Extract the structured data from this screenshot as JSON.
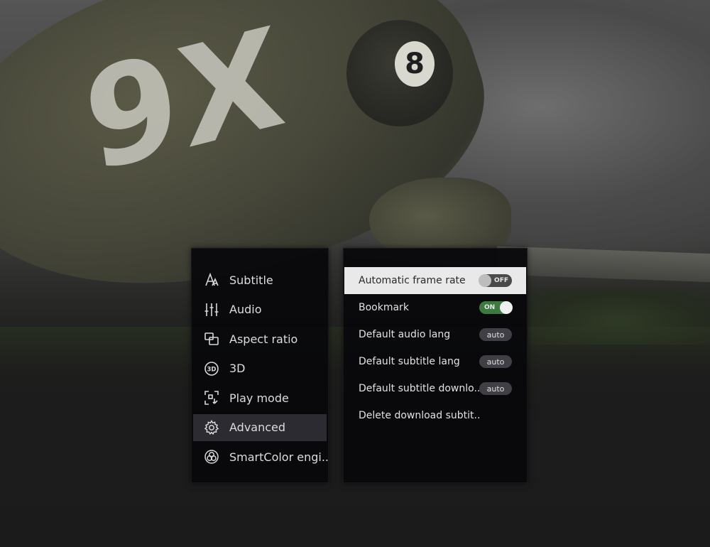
{
  "background": {
    "tail_code": "9X",
    "roundel_number": "8"
  },
  "menu": {
    "items": [
      {
        "label": "Subtitle",
        "icon": "subtitle-icon"
      },
      {
        "label": "Audio",
        "icon": "audio-equalizer-icon"
      },
      {
        "label": "Aspect ratio",
        "icon": "aspect-ratio-icon"
      },
      {
        "label": "3D",
        "icon": "3d-icon"
      },
      {
        "label": "Play mode",
        "icon": "play-mode-icon"
      },
      {
        "label": "Advanced",
        "icon": "gear-icon"
      },
      {
        "label": "SmartColor engi..",
        "icon": "smartcolor-icon"
      }
    ],
    "active_index": 5
  },
  "settings": {
    "rows": [
      {
        "label": "Automatic frame rate",
        "control": "toggle",
        "value": "OFF"
      },
      {
        "label": "Bookmark",
        "control": "toggle",
        "value": "ON"
      },
      {
        "label": "Default audio lang",
        "control": "pill",
        "value": "auto"
      },
      {
        "label": "Default subtitle lang",
        "control": "pill",
        "value": "auto"
      },
      {
        "label": "Default subtitle downlo..",
        "control": "pill",
        "value": "auto"
      },
      {
        "label": "Delete download subtit..",
        "control": "none",
        "value": ""
      }
    ],
    "active_index": 0
  },
  "colors": {
    "panel_bg": "#08080c",
    "menu_active_bg": "#2b2b31",
    "row_active_bg": "#e9e9e9",
    "toggle_on": "#3c7a3f",
    "toggle_off": "#4a4a4a",
    "pill_bg": "#3f3f45"
  }
}
